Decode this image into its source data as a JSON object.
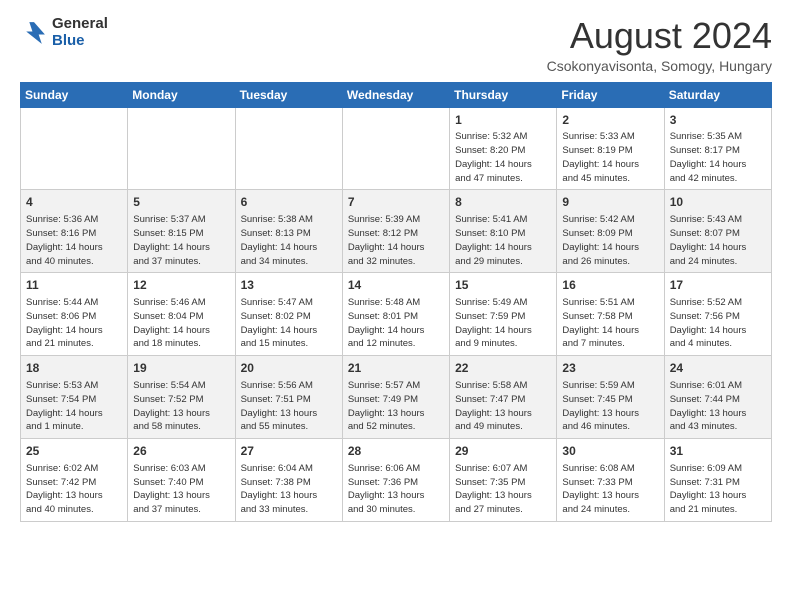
{
  "logo": {
    "general": "General",
    "blue": "Blue"
  },
  "header": {
    "month": "August 2024",
    "location": "Csokonyavisonta, Somogy, Hungary"
  },
  "weekdays": [
    "Sunday",
    "Monday",
    "Tuesday",
    "Wednesday",
    "Thursday",
    "Friday",
    "Saturday"
  ],
  "weeks": [
    [
      {
        "day": "",
        "info": ""
      },
      {
        "day": "",
        "info": ""
      },
      {
        "day": "",
        "info": ""
      },
      {
        "day": "",
        "info": ""
      },
      {
        "day": "1",
        "info": "Sunrise: 5:32 AM\nSunset: 8:20 PM\nDaylight: 14 hours\nand 47 minutes."
      },
      {
        "day": "2",
        "info": "Sunrise: 5:33 AM\nSunset: 8:19 PM\nDaylight: 14 hours\nand 45 minutes."
      },
      {
        "day": "3",
        "info": "Sunrise: 5:35 AM\nSunset: 8:17 PM\nDaylight: 14 hours\nand 42 minutes."
      }
    ],
    [
      {
        "day": "4",
        "info": "Sunrise: 5:36 AM\nSunset: 8:16 PM\nDaylight: 14 hours\nand 40 minutes."
      },
      {
        "day": "5",
        "info": "Sunrise: 5:37 AM\nSunset: 8:15 PM\nDaylight: 14 hours\nand 37 minutes."
      },
      {
        "day": "6",
        "info": "Sunrise: 5:38 AM\nSunset: 8:13 PM\nDaylight: 14 hours\nand 34 minutes."
      },
      {
        "day": "7",
        "info": "Sunrise: 5:39 AM\nSunset: 8:12 PM\nDaylight: 14 hours\nand 32 minutes."
      },
      {
        "day": "8",
        "info": "Sunrise: 5:41 AM\nSunset: 8:10 PM\nDaylight: 14 hours\nand 29 minutes."
      },
      {
        "day": "9",
        "info": "Sunrise: 5:42 AM\nSunset: 8:09 PM\nDaylight: 14 hours\nand 26 minutes."
      },
      {
        "day": "10",
        "info": "Sunrise: 5:43 AM\nSunset: 8:07 PM\nDaylight: 14 hours\nand 24 minutes."
      }
    ],
    [
      {
        "day": "11",
        "info": "Sunrise: 5:44 AM\nSunset: 8:06 PM\nDaylight: 14 hours\nand 21 minutes."
      },
      {
        "day": "12",
        "info": "Sunrise: 5:46 AM\nSunset: 8:04 PM\nDaylight: 14 hours\nand 18 minutes."
      },
      {
        "day": "13",
        "info": "Sunrise: 5:47 AM\nSunset: 8:02 PM\nDaylight: 14 hours\nand 15 minutes."
      },
      {
        "day": "14",
        "info": "Sunrise: 5:48 AM\nSunset: 8:01 PM\nDaylight: 14 hours\nand 12 minutes."
      },
      {
        "day": "15",
        "info": "Sunrise: 5:49 AM\nSunset: 7:59 PM\nDaylight: 14 hours\nand 9 minutes."
      },
      {
        "day": "16",
        "info": "Sunrise: 5:51 AM\nSunset: 7:58 PM\nDaylight: 14 hours\nand 7 minutes."
      },
      {
        "day": "17",
        "info": "Sunrise: 5:52 AM\nSunset: 7:56 PM\nDaylight: 14 hours\nand 4 minutes."
      }
    ],
    [
      {
        "day": "18",
        "info": "Sunrise: 5:53 AM\nSunset: 7:54 PM\nDaylight: 14 hours\nand 1 minute."
      },
      {
        "day": "19",
        "info": "Sunrise: 5:54 AM\nSunset: 7:52 PM\nDaylight: 13 hours\nand 58 minutes."
      },
      {
        "day": "20",
        "info": "Sunrise: 5:56 AM\nSunset: 7:51 PM\nDaylight: 13 hours\nand 55 minutes."
      },
      {
        "day": "21",
        "info": "Sunrise: 5:57 AM\nSunset: 7:49 PM\nDaylight: 13 hours\nand 52 minutes."
      },
      {
        "day": "22",
        "info": "Sunrise: 5:58 AM\nSunset: 7:47 PM\nDaylight: 13 hours\nand 49 minutes."
      },
      {
        "day": "23",
        "info": "Sunrise: 5:59 AM\nSunset: 7:45 PM\nDaylight: 13 hours\nand 46 minutes."
      },
      {
        "day": "24",
        "info": "Sunrise: 6:01 AM\nSunset: 7:44 PM\nDaylight: 13 hours\nand 43 minutes."
      }
    ],
    [
      {
        "day": "25",
        "info": "Sunrise: 6:02 AM\nSunset: 7:42 PM\nDaylight: 13 hours\nand 40 minutes."
      },
      {
        "day": "26",
        "info": "Sunrise: 6:03 AM\nSunset: 7:40 PM\nDaylight: 13 hours\nand 37 minutes."
      },
      {
        "day": "27",
        "info": "Sunrise: 6:04 AM\nSunset: 7:38 PM\nDaylight: 13 hours\nand 33 minutes."
      },
      {
        "day": "28",
        "info": "Sunrise: 6:06 AM\nSunset: 7:36 PM\nDaylight: 13 hours\nand 30 minutes."
      },
      {
        "day": "29",
        "info": "Sunrise: 6:07 AM\nSunset: 7:35 PM\nDaylight: 13 hours\nand 27 minutes."
      },
      {
        "day": "30",
        "info": "Sunrise: 6:08 AM\nSunset: 7:33 PM\nDaylight: 13 hours\nand 24 minutes."
      },
      {
        "day": "31",
        "info": "Sunrise: 6:09 AM\nSunset: 7:31 PM\nDaylight: 13 hours\nand 21 minutes."
      }
    ]
  ]
}
